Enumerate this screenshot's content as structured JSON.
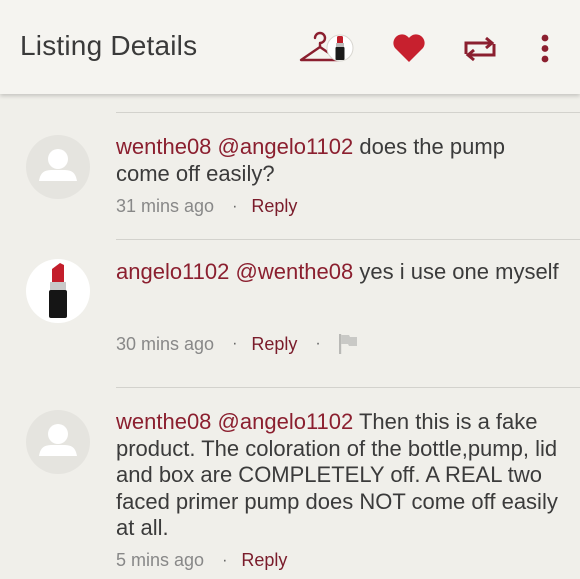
{
  "header": {
    "title": "Listing Details",
    "icons": [
      "hanger-icon",
      "heart-icon",
      "share-icon",
      "more-icon"
    ],
    "accent_color": "#c0202f"
  },
  "comments": [
    {
      "user": "wenthe08",
      "mention": "@angelo1102",
      "text": " does the pump come off easily?",
      "time": "31 mins ago",
      "separator": "·",
      "reply": "Reply",
      "avatar": "placeholder-avatar"
    },
    {
      "user": "angelo1102",
      "mention": "@wenthe08",
      "text": " yes i use one myself",
      "time": "30 mins ago",
      "separator": "·",
      "reply": "Reply",
      "separator2": "·",
      "avatar": "lipstick-avatar",
      "flag": "flag-icon"
    },
    {
      "user": "wenthe08",
      "mention": "@angelo1102",
      "text": " Then this is a fake product. The coloration of the bottle,pump, lid and box are COMPLETELY off. A REAL two faced primer pump does NOT come off easily at all.",
      "time": "5 mins ago",
      "separator": "·",
      "reply": "Reply",
      "avatar": "placeholder-avatar"
    }
  ]
}
